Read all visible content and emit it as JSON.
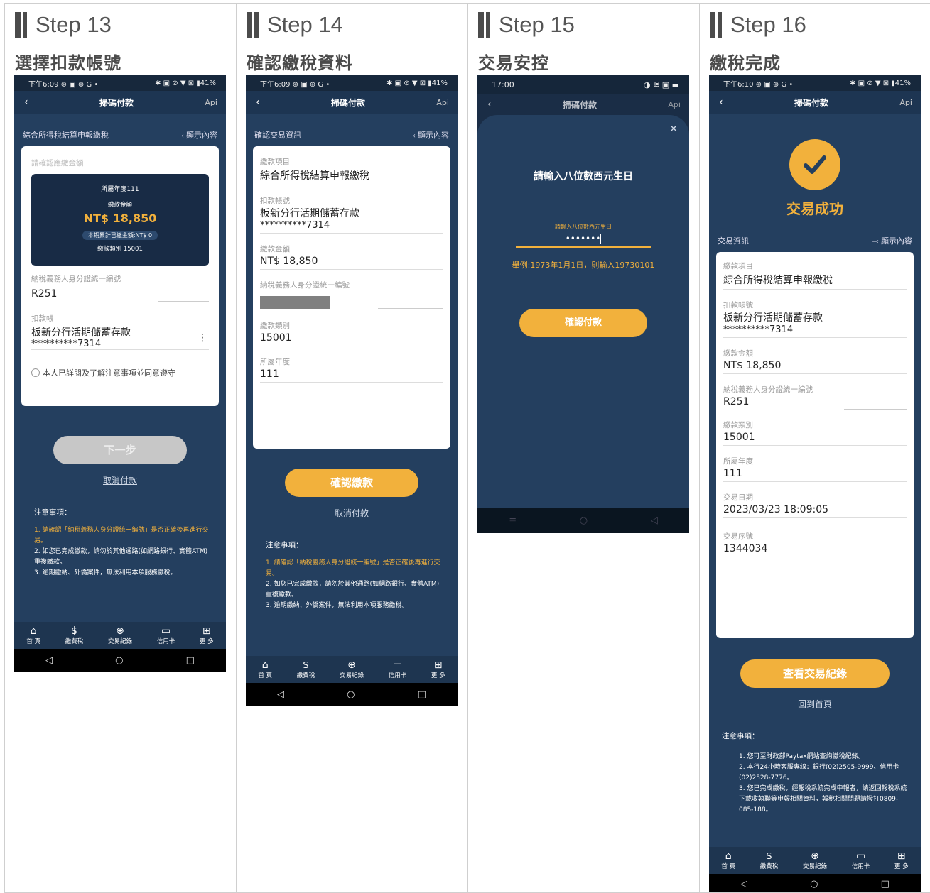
{
  "steps": [
    {
      "label": "Step 13",
      "title": "選擇扣款帳號"
    },
    {
      "label": "Step 14",
      "title": "確認繳稅資料"
    },
    {
      "label": "Step 15",
      "title": "交易安控"
    },
    {
      "label": "Step 16",
      "title": "繳稅完成"
    }
  ],
  "status": {
    "time": "下午6:09",
    "icons": "⊛ ▣ ⊕ G •",
    "right": "✱ ▣ ⊘ ▼ ⊠ ▮41%",
    "time16": "下午6:10",
    "time15": "17:00",
    "right15": "◑ ≋ ▣ ▬"
  },
  "app": {
    "title": "掃碼付款",
    "api": "Api",
    "back": "‹"
  },
  "s13": {
    "section": "綜合所得稅結算申報繳稅",
    "show": "⤙ 顯示內容",
    "confirm_amt": "請確認應繳金額",
    "year": "所屬年度111",
    "amt_label": "繳款金額",
    "amount": "NT$ 18,850",
    "accum": "本期累計已繳金額:NT$ 0",
    "type": "繳款類別 15001",
    "id_label": "納稅義務人身分證統一編號",
    "id_val": "R251",
    "acct_label": "扣款帳",
    "acct_name": "板新分行活期儲蓄存款",
    "acct_no": "**********7314",
    "more": "⋮",
    "agree": "本人已詳閱及了解注意事項並同意遵守",
    "next": "下一步",
    "cancel": "取消付款"
  },
  "s14": {
    "section": "確認交易資訊",
    "show": "⤙ 顯示內容",
    "fields": [
      {
        "l": "繳款項目",
        "v": "綜合所得稅結算申報繳稅"
      },
      {
        "l": "扣款帳號",
        "v": "板新分行活期儲蓄存款",
        "v2": "**********7314"
      },
      {
        "l": "繳款金額",
        "v": "NT$ 18,850"
      },
      {
        "l": "納稅義務人身分證統一編號",
        "v": ""
      },
      {
        "l": "繳款類別",
        "v": "15001"
      },
      {
        "l": "所屬年度",
        "v": "111"
      }
    ],
    "confirm": "確認繳款",
    "cancel": "取消付款"
  },
  "s15": {
    "prompt": "請輸入八位數西元生日",
    "input_label": "請輸入八位數西元生日",
    "input_val": "•••••••",
    "example": "舉例:1973年1月1日，則輸入19730101",
    "pay": "確認付款",
    "close": "✕"
  },
  "s16": {
    "success": "交易成功",
    "section": "交易資訊",
    "show": "⤙ 顯示內容",
    "fields": [
      {
        "l": "繳款項目",
        "v": "綜合所得稅結算申報繳稅"
      },
      {
        "l": "扣款帳號",
        "v": "板新分行活期儲蓄存款",
        "v2": "**********7314"
      },
      {
        "l": "繳款金額",
        "v": "NT$ 18,850"
      },
      {
        "l": "納稅義務人身分證統一編號",
        "v": "R251"
      },
      {
        "l": "繳款類別",
        "v": "15001"
      },
      {
        "l": "所屬年度",
        "v": "111"
      },
      {
        "l": "交易日期",
        "v": "2023/03/23 18:09:05"
      },
      {
        "l": "交易序號",
        "v": "1344034"
      }
    ],
    "view": "查看交易紀錄",
    "home": "回到首頁",
    "notes_title": "注意事項：",
    "notes": [
      "1. 您可至財政部Paytax網站查詢繳稅紀錄。",
      "2. 本行24小時客服專線：銀行(02)2505-9999、信用卡(02)2528-7776。",
      "3. 您已完成繳稅，經報稅系統完成申報者，請返回報稅系統下載收執聯等申報相關資料，報稅相關問題請撥打0809-085-188。"
    ]
  },
  "notes": {
    "title": "注意事項：",
    "items": [
      "1. 請確認「納稅義務人身分證統一編號」是否正確後再進行交易。",
      "2. 如您已完成繳款，請勿於其他通路(如網路銀行、實體ATM)重複繳款。",
      "3. 逾期繳納、外僑案件，無法利用本項服務繳稅。"
    ]
  },
  "nav": [
    {
      "icon": "⌂",
      "label": "首 頁"
    },
    {
      "icon": "$",
      "label": "繳費稅"
    },
    {
      "icon": "⊕",
      "label": "交易紀錄"
    },
    {
      "icon": "▭",
      "label": "信用卡"
    },
    {
      "icon": "⊞",
      "label": "更 多"
    }
  ],
  "sys": {
    "back": "◁",
    "home": "○",
    "recent": "□",
    "menu": "≡"
  }
}
